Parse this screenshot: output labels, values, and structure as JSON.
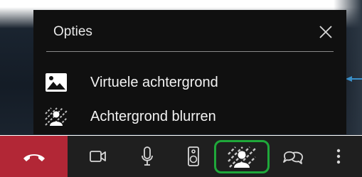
{
  "options": {
    "title": "Opties",
    "items": [
      {
        "label": "Virtuele achtergrond",
        "icon": "image-icon"
      },
      {
        "label": "Achtergrond blurren",
        "icon": "blur-background-icon"
      }
    ]
  },
  "toolbar": {
    "buttons": [
      "hang-up",
      "camera",
      "microphone",
      "speaker",
      "background-effects",
      "chat",
      "more-options"
    ],
    "active": "background-effects"
  },
  "colors": {
    "hangup": "#b22736",
    "active_outline": "#1fa83a",
    "panel": "#101010",
    "toolbar": "#1f1f1f",
    "pointer": "#3a8fc8"
  }
}
